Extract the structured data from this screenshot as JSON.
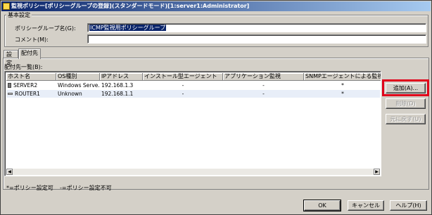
{
  "window": {
    "title": "監視ポリシー[ポリシーグループの登録](スタンダードモード)[1:server1:Administrator]"
  },
  "basic_settings": {
    "group_label": "基本設定",
    "policy_group_name_label": "ポリシーグループ名(G):",
    "policy_group_name_value": "ICMP監視用ポリシーグループ",
    "comment_label": "コメント(M):",
    "comment_value": ""
  },
  "tabs": [
    {
      "label": "設定",
      "active": false
    },
    {
      "label": "配付先",
      "active": true
    }
  ],
  "deploy_list": {
    "label": "配付先一覧(B):",
    "columns": [
      "ホスト名",
      "OS種別",
      "IPアドレス",
      "インストール型エージェント",
      "アプリケーション監視",
      "SNMPエージェントによる監視"
    ],
    "rows": [
      {
        "host": "SERVER2",
        "icon": "server-icon",
        "os": "Windows Serve...",
        "ip": "192.168.1.3",
        "agent": "-",
        "app": "-",
        "snmp": "*"
      },
      {
        "host": "ROUTER1",
        "icon": "router-icon",
        "os": "Unknown",
        "ip": "192.168.1.1",
        "agent": "-",
        "app": "-",
        "snmp": "*"
      }
    ]
  },
  "side_buttons": {
    "add": "追加(A)...",
    "delete": "削除(D)",
    "restore": "元に戻す(U)"
  },
  "legend": {
    "allowed": "*=ポリシー設定可",
    "not_allowed": "-=ポリシー設定不可"
  },
  "footer": {
    "ok": "OK",
    "cancel": "キャンセル",
    "help": "ヘルプ(H)"
  },
  "colors": {
    "highlight": "#e0001a",
    "titlebar": "#0a246a"
  }
}
